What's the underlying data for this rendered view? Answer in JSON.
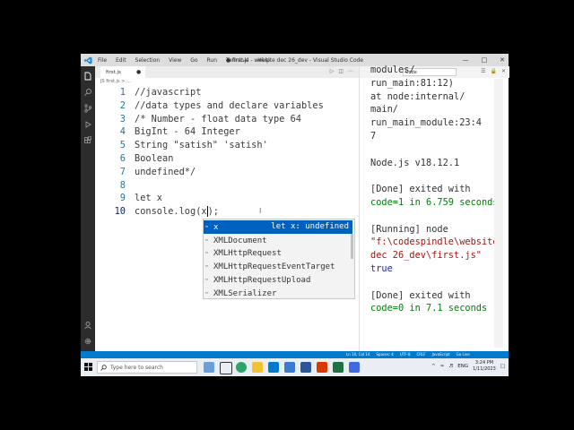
{
  "window": {
    "title": "● first.js - website dec 26_dev - Visual Studio Code",
    "menu": [
      "File",
      "Edit",
      "Selection",
      "View",
      "Go",
      "Run",
      "Terminal",
      "Help"
    ]
  },
  "tab": {
    "label": "first.js",
    "dirty_marker": "●"
  },
  "breadcrumb": "JS first.js > ...",
  "editor_lines": [
    {
      "num": "1",
      "text": "//javascript"
    },
    {
      "num": "2",
      "text": "//data types and declare variables"
    },
    {
      "num": "3",
      "text": "/* Number - float data type 64"
    },
    {
      "num": "4",
      "text": "BigInt - 64 Integer"
    },
    {
      "num": "5",
      "text": "String \"satish\" 'satish'"
    },
    {
      "num": "6",
      "text": "Boolean"
    },
    {
      "num": "7",
      "text": "undefined*/"
    },
    {
      "num": "8",
      "text": ""
    },
    {
      "num": "9",
      "text": "let x"
    },
    {
      "num": "10",
      "text_before": "console.log(x",
      "text_after": ");"
    }
  ],
  "suggest": {
    "items": [
      {
        "label": "x",
        "detail": "let x: undefined",
        "selected": true
      },
      {
        "label": "XMLDocument"
      },
      {
        "label": "XMLHttpRequest"
      },
      {
        "label": "XMLHttpRequestEventTarget"
      },
      {
        "label": "XMLHttpRequestUpload"
      },
      {
        "label": "XMLSerializer"
      }
    ]
  },
  "output": {
    "dropdown_value": "Code",
    "lines": [
      "modules/",
      "run_main:81:12)",
      "at node:internal/",
      "main/",
      "run_main_module:23:4",
      "7",
      "",
      "Node.js v18.12.1",
      "",
      "[Done] exited with",
      "code=1 in 6.759 seconds",
      "",
      "[Running] node",
      "\"f:\\codespindle\\website",
      "dec 26_dev\\first.js\"",
      "true",
      "",
      "[Done] exited with",
      "code=0 in 7.1 seconds"
    ]
  },
  "statusbar": {
    "items": [
      "Ln 10, Col 14",
      "Spaces: 4",
      "UTF-8",
      "CRLF",
      "JavaScript",
      "Go Live"
    ]
  },
  "taskbar": {
    "search_placeholder": "Type here to search",
    "lang": "ENG",
    "time": "3:24 PM",
    "date": "1/11/2023"
  },
  "colors": {
    "accent": "#007acc",
    "suggest_selected": "#0060c0",
    "line_number": "#237893",
    "output_green": "#00800b",
    "output_blue": "#1d26b8"
  }
}
